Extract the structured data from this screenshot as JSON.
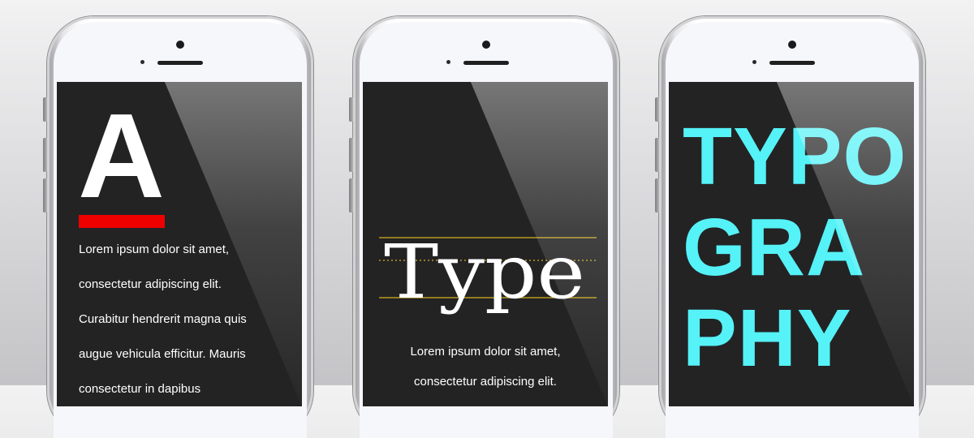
{
  "phone_left": {
    "headline_letter": "A",
    "paragraph_lines": [
      "Lorem ipsum dolor sit amet,",
      "consectetur adipiscing elit.",
      "Curabitur hendrerit magna quis",
      "augue vehicula efficitur. Mauris",
      "consectetur in dapibus"
    ],
    "accent_color": "#ee0000"
  },
  "phone_middle": {
    "display_word": "Type",
    "guide_color": "#d4b21e",
    "paragraph_lines": [
      "Lorem ipsum dolor sit amet,",
      "consectetur adipiscing elit."
    ]
  },
  "phone_right": {
    "display_lines": [
      "TYPO",
      "GRA",
      "PHY"
    ],
    "text_color": "#55f2f7"
  }
}
